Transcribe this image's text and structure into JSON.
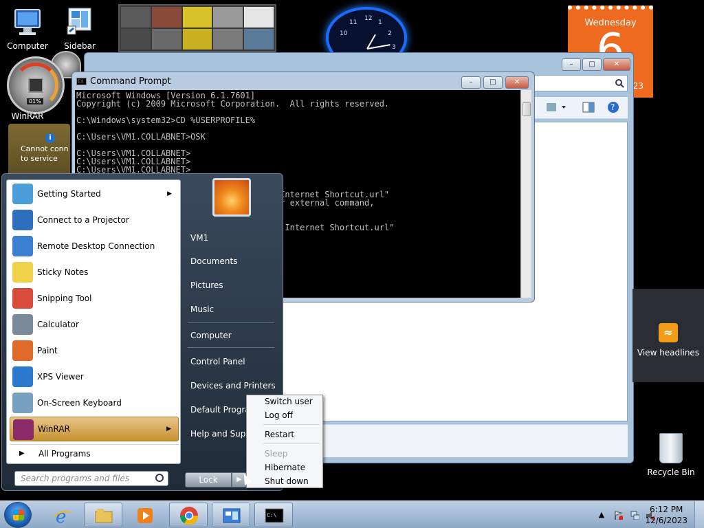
{
  "desktop": {
    "icons": [
      {
        "label": "Computer",
        "icon": "computer-icon"
      },
      {
        "label": "Sidebar",
        "icon": "sidebar-icon"
      },
      {
        "label": "WinRAR",
        "icon": "winrar-icon"
      },
      {
        "label": "Recycle Bin",
        "icon": "recycle-bin-icon"
      }
    ],
    "gadgets": {
      "cpu_meter_percent": "01%",
      "weather_message": "Cannot connect to service",
      "weather_line1": "Cannot conn",
      "weather_line2": "to service",
      "calendar_day": "Wednesday",
      "calendar_date": "6",
      "calendar_year": "23",
      "feed_label": "View headlines",
      "clock_numbers": [
        "12",
        "1",
        "2",
        "3",
        "10",
        "11"
      ]
    }
  },
  "cmd": {
    "title": "Command Prompt",
    "lines": [
      "Microsoft Windows [Version 6.1.7601]",
      "Copyright (c) 2009 Microsoft Corporation.  All rights reserved.",
      "",
      "C:\\Windows\\system32>CD %USERPROFILE%",
      "",
      "C:\\Users\\VM1.COLLABNET>OSK",
      "",
      "C:\\Users\\VM1.COLLABNET>",
      "C:\\Users\\VM1.COLLABNET>",
      "C:\\Users\\VM1.COLLABNET>",
      "",
      "",
      "                                      ew Internet Shortcut.url\"",
      "                                      l or external command,",
      "",
      "",
      "                                      lew Internet Shortcut.url\"",
      "                                      }]"
    ]
  },
  "start_menu": {
    "programs": [
      {
        "label": "Getting Started",
        "icon": "getting-started-icon",
        "submenu": true
      },
      {
        "label": "Connect to a Projector",
        "icon": "projector-icon",
        "submenu": false
      },
      {
        "label": "Remote Desktop Connection",
        "icon": "remote-desktop-icon",
        "submenu": false
      },
      {
        "label": "Sticky Notes",
        "icon": "sticky-notes-icon",
        "submenu": false
      },
      {
        "label": "Snipping Tool",
        "icon": "snipping-tool-icon",
        "submenu": false
      },
      {
        "label": "Calculator",
        "icon": "calculator-icon",
        "submenu": false
      },
      {
        "label": "Paint",
        "icon": "paint-icon",
        "submenu": false
      },
      {
        "label": "XPS Viewer",
        "icon": "xps-viewer-icon",
        "submenu": false
      },
      {
        "label": "On-Screen Keyboard",
        "icon": "keyboard-icon",
        "submenu": false
      },
      {
        "label": "WinRAR",
        "icon": "winrar-icon",
        "submenu": true
      }
    ],
    "all_programs": "All Programs",
    "search_placeholder": "Search programs and files",
    "right_items": [
      "VM1",
      "Documents",
      "Pictures",
      "Music",
      "Computer",
      "Control Panel",
      "Devices and Printers",
      "Default Programs",
      "Help and Support"
    ],
    "lock_label": "Lock",
    "power_submenu": [
      {
        "label": "Switch user",
        "enabled": true
      },
      {
        "label": "Log off",
        "enabled": true
      },
      {
        "label": "Restart",
        "enabled": true
      },
      {
        "label": "Sleep",
        "enabled": false
      },
      {
        "label": "Hibernate",
        "enabled": true
      },
      {
        "label": "Shut down",
        "enabled": true
      }
    ]
  },
  "taskbar": {
    "buttons": [
      "internet-explorer-icon",
      "windows-explorer-icon",
      "media-player-icon",
      "chrome-icon",
      "control-panel-icon",
      "command-prompt-icon"
    ],
    "time": "6:12 PM",
    "date": "12/6/2023"
  },
  "colors": {
    "desktop_bg": "#000000",
    "highlight": "#d9a84a",
    "calendar": "#ee6a1f"
  }
}
